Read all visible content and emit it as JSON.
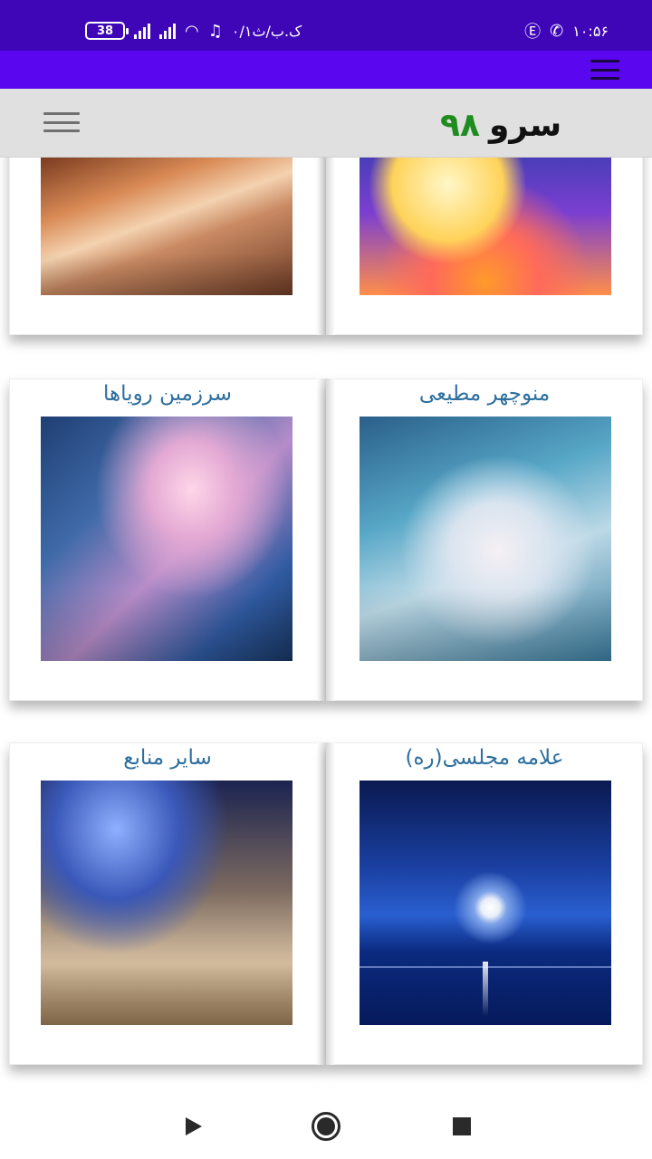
{
  "status_bar": {
    "battery": "38",
    "carrier_text": "۰/۱ک.ب/ث",
    "time": "۱۰:۵۶"
  },
  "header": {
    "brand_word": "سرو",
    "brand_number": "۹۸"
  },
  "cards": [
    {
      "title": "",
      "image": "girl-sleeping-on-book"
    },
    {
      "title": "",
      "image": "moon-in-clouds"
    },
    {
      "title": "سرزمین رویاها",
      "image": "girl-in-dream-book"
    },
    {
      "title": "منوچهر مطیعی",
      "image": "girl-sleeping-in-clouds"
    },
    {
      "title": "سایر منابع",
      "image": "girl-sleeping-at-desk"
    },
    {
      "title": "علامه مجلسی(ره)",
      "image": "full-moon-over-sea"
    }
  ],
  "colors": {
    "status_bar": "#3f06b8",
    "app_bar": "#5a06ef",
    "header": "#e0e0e0",
    "card_title": "#2d6f9e",
    "brand_green": "#1e8c1e"
  }
}
